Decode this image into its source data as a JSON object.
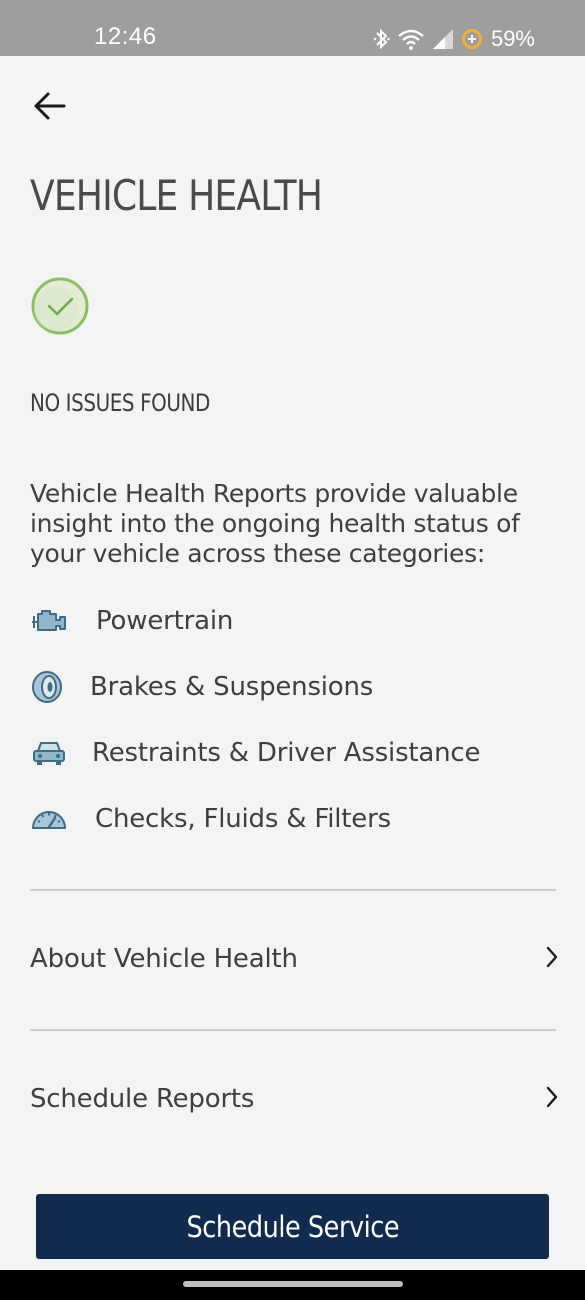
{
  "status_bar": {
    "time": "12:46",
    "battery_percent": "59%",
    "icons": [
      "bluetooth-icon",
      "wifi-icon",
      "signal-icon",
      "battery-saver-icon"
    ]
  },
  "header": {
    "back_icon": "arrow-left-icon",
    "title": "VEHICLE HEALTH"
  },
  "status": {
    "icon": "check-circle-icon",
    "color": "#8cbf5f",
    "text": "NO ISSUES FOUND"
  },
  "intro": "Vehicle Health Reports provide valuable insight into the ongoing health status of your vehicle across these categories:",
  "categories": [
    {
      "icon": "engine-icon",
      "label": "Powertrain"
    },
    {
      "icon": "tire-icon",
      "label": "Brakes & Suspensions"
    },
    {
      "icon": "car-icon",
      "label": "Restraints & Driver Assistance"
    },
    {
      "icon": "gauge-icon",
      "label": "Checks, Fluids & Filters"
    }
  ],
  "links": [
    {
      "label": "About Vehicle Health",
      "icon": "chevron-right-icon"
    },
    {
      "label": "Schedule Reports",
      "icon": "chevron-right-icon"
    }
  ],
  "cta": {
    "label": "Schedule Service",
    "color": "#112b4f"
  },
  "colors": {
    "icon_blue": "#3d6e85",
    "background": "#f4f4f4"
  }
}
